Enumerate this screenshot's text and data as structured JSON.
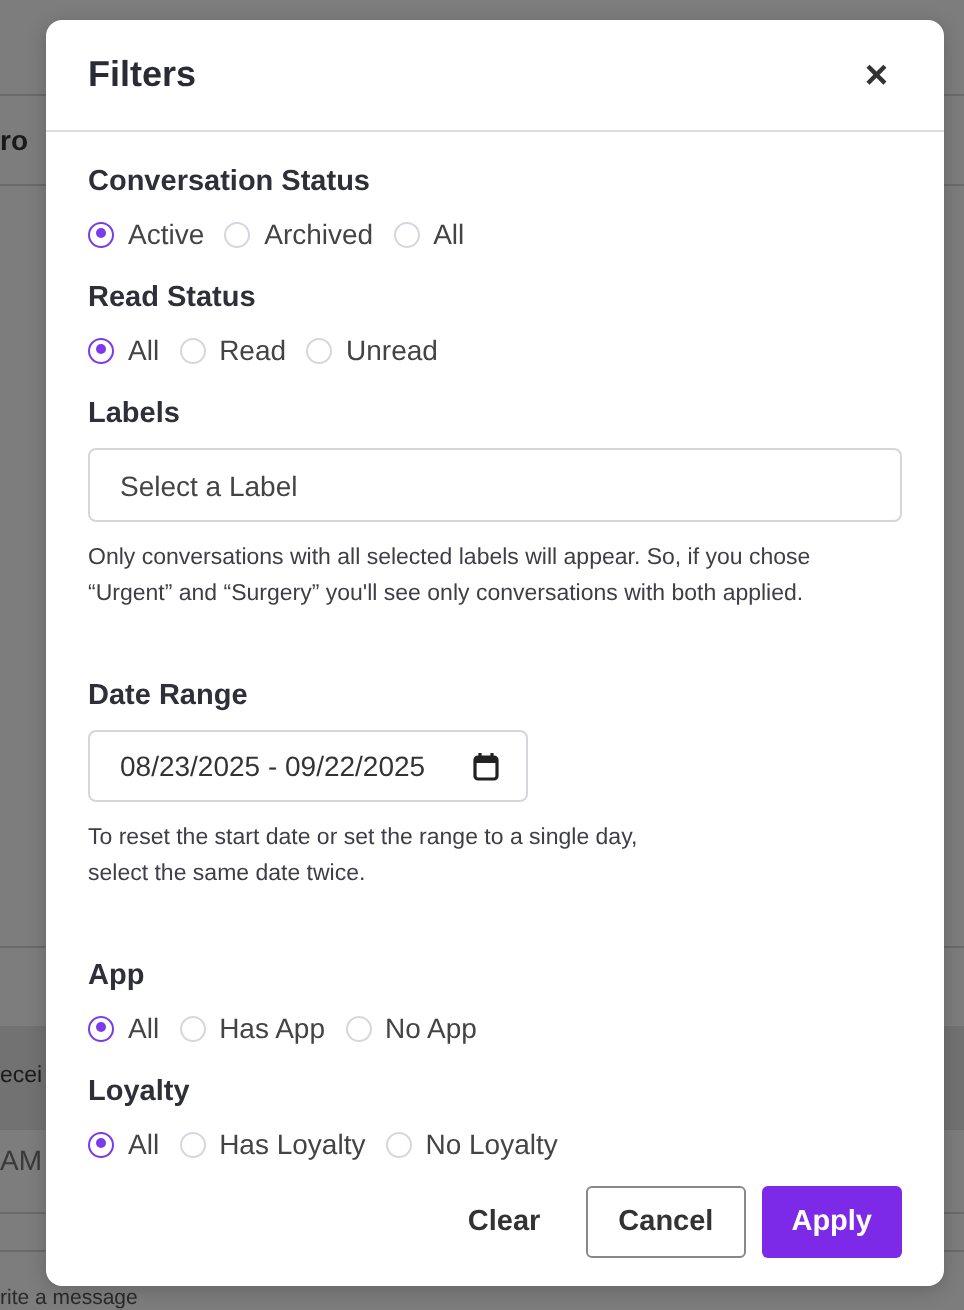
{
  "background": {
    "fragments": [
      {
        "text": "ro",
        "kind": "header"
      },
      {
        "text": "ecei",
        "kind": "row"
      },
      {
        "text": "AM",
        "kind": "time"
      },
      {
        "text": "rite a message",
        "kind": "composer"
      }
    ]
  },
  "dialog": {
    "title": "Filters",
    "close": "×",
    "sections": [
      {
        "kind": "radio",
        "label": "Conversation Status",
        "options": [
          {
            "label": "Active",
            "selected": true
          },
          {
            "label": "Archived",
            "selected": false
          },
          {
            "label": "All",
            "selected": false
          }
        ]
      },
      {
        "kind": "radio",
        "label": "Read Status",
        "options": [
          {
            "label": "All",
            "selected": true
          },
          {
            "label": "Read",
            "selected": false
          },
          {
            "label": "Unread",
            "selected": false
          }
        ]
      },
      {
        "kind": "select",
        "label": "Labels",
        "placeholder": "Select a Label",
        "help": [
          "Only conversations with all selected labels will appear. So, if you chose",
          "“Urgent” and “Surgery” you'll see only conversations with both applied."
        ]
      },
      {
        "kind": "daterange",
        "label": "Date Range",
        "value": "08/23/2025 - 09/22/2025",
        "help": [
          "To reset the start date or set the range to a single day,",
          "select the same date twice."
        ]
      },
      {
        "kind": "radio",
        "label": "App",
        "options": [
          {
            "label": "All",
            "selected": true
          },
          {
            "label": "Has App",
            "selected": false
          },
          {
            "label": "No App",
            "selected": false
          }
        ]
      },
      {
        "kind": "radio",
        "label": "Loyalty",
        "options": [
          {
            "label": "All",
            "selected": true
          },
          {
            "label": "Has Loyalty",
            "selected": false
          },
          {
            "label": "No Loyalty",
            "selected": false
          }
        ]
      }
    ],
    "buttons": [
      {
        "label": "Clear",
        "kind": "text"
      },
      {
        "label": "Cancel",
        "kind": "outline"
      },
      {
        "label": "Apply",
        "kind": "primary"
      }
    ]
  }
}
